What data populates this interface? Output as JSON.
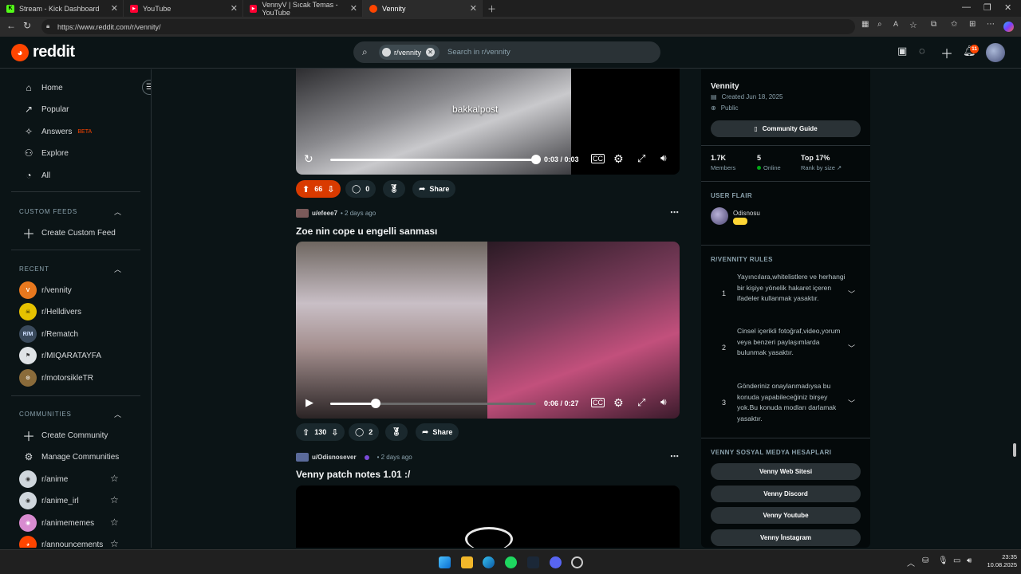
{
  "browser": {
    "tabs": [
      {
        "label": "Stream - Kick Dashboard",
        "color": "#53fc18",
        "glyph": "K"
      },
      {
        "label": "YouTube",
        "color": "#ff0033",
        "glyph": "▶"
      },
      {
        "label": "VennyV | Sıcak Temas - YouTube",
        "color": "#ff0033",
        "glyph": "▶"
      },
      {
        "label": "Vennity",
        "color": "#ff4500",
        "glyph": "●"
      }
    ],
    "url": "https://www.reddit.com/r/vennity/"
  },
  "header": {
    "logo_text": "reddit",
    "search_chip": "r/vennity",
    "search_placeholder": "Search in r/vennity",
    "notification_count": "11"
  },
  "left_nav": {
    "items": [
      {
        "label": "Home",
        "icon": "home-icon"
      },
      {
        "label": "Popular",
        "icon": "popular-icon"
      },
      {
        "label": "Answers",
        "badge": "BETA",
        "icon": "answers-icon"
      },
      {
        "label": "Explore",
        "icon": "explore-icon"
      },
      {
        "label": "All",
        "icon": "all-icon"
      }
    ],
    "custom_feeds_header": "CUSTOM FEEDS",
    "create_custom_feed": "Create Custom Feed",
    "recent_header": "RECENT",
    "recent": [
      "r/vennity",
      "r/Helldivers",
      "r/Rematch",
      "r/MIQARATAYFA",
      "r/motorsikleTR"
    ],
    "communities_header": "COMMUNITIES",
    "create_community": "Create Community",
    "manage_communities": "Manage Communities",
    "communities": [
      "r/anime",
      "r/anime_irl",
      "r/animememes",
      "r/announcements"
    ]
  },
  "feed": {
    "post1": {
      "overlay_text": "bakkalpost",
      "time": "0:03 / 0:03",
      "progress": 1.0,
      "votes": "66",
      "comments": "0",
      "share": "Share"
    },
    "post2": {
      "author": "u/efeee7",
      "age": "• 2 days ago",
      "title": "Zoe nin cope u engelli sanması",
      "time": "0:06 / 0:27",
      "progress": 0.222,
      "votes": "130",
      "comments": "2",
      "share": "Share"
    },
    "post3": {
      "author": "u/Odisnosever",
      "age": "• 2 days ago",
      "title": "Venny patch notes 1.01 :/"
    }
  },
  "right_sidebar": {
    "community_name": "Vennity",
    "created": "Created Jun 18, 2025",
    "visibility": "Public",
    "community_guide": "Community Guide",
    "stats": [
      {
        "value": "1.7K",
        "label": "Members"
      },
      {
        "value": "5",
        "label": "Online"
      },
      {
        "value": "Top 17%",
        "label": "Rank by size"
      }
    ],
    "user_flair_header": "USER FLAIR",
    "flair_user": "Odisnosu",
    "rules_header": "R/VENNITY RULES",
    "rules": [
      {
        "num": "1",
        "text": "Yayıncılara,whitelistlere ve herhangi bir kişiye yönelik hakaret içeren ifadeler kullanmak yasaktır."
      },
      {
        "num": "2",
        "text": "Cinsel içerikli fotoğraf,video,yorum veya benzeri paylaşımlarda bulunmak yasaktır."
      },
      {
        "num": "3",
        "text": "Gönderiniz onaylanmadıysa bu konuda yapabileceğiniz birşey yok.Bu konuda modları darlamak yasaktır."
      }
    ],
    "social_header": "VENNY SOSYAL MEDYA HESAPLARI",
    "social_links": [
      "Venny Web Sitesi",
      "Venny Discord",
      "Venny Youtube",
      "Venny İnstagram"
    ]
  },
  "taskbar": {
    "time": "23:35",
    "date": "10.08.2025"
  }
}
